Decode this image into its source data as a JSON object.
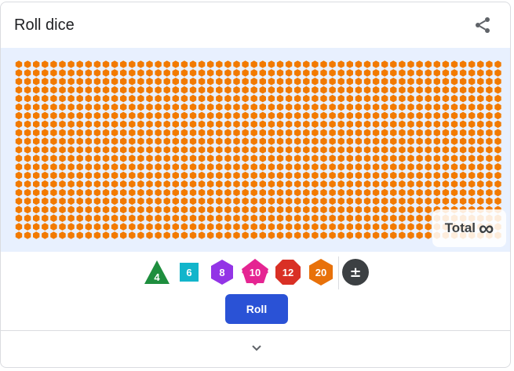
{
  "header": {
    "title": "Roll dice",
    "share_icon": "share-icon"
  },
  "board": {
    "die_color": "#f27a00",
    "background": "#e8f0fe",
    "total_label": "Total",
    "total_value": "∞"
  },
  "dice_buttons": [
    {
      "label": "4",
      "sides": 4,
      "shape": "triangle",
      "color": "#1e8e3e"
    },
    {
      "label": "6",
      "sides": 6,
      "shape": "square",
      "color": "#12b5cb"
    },
    {
      "label": "8",
      "sides": 8,
      "shape": "hexagon",
      "color": "#9334e6"
    },
    {
      "label": "10",
      "sides": 10,
      "shape": "diamond",
      "color": "#e52592"
    },
    {
      "label": "12",
      "sides": 12,
      "shape": "octagon",
      "color": "#d93025"
    },
    {
      "label": "20",
      "sides": 20,
      "shape": "hexagon",
      "color": "#e8710a"
    }
  ],
  "modifier_button": {
    "label": "±",
    "color": "#3c4043"
  },
  "roll_button": {
    "label": "Roll",
    "color": "#2a52d6"
  },
  "footer": {
    "expand_icon": "chevron-down-icon"
  }
}
